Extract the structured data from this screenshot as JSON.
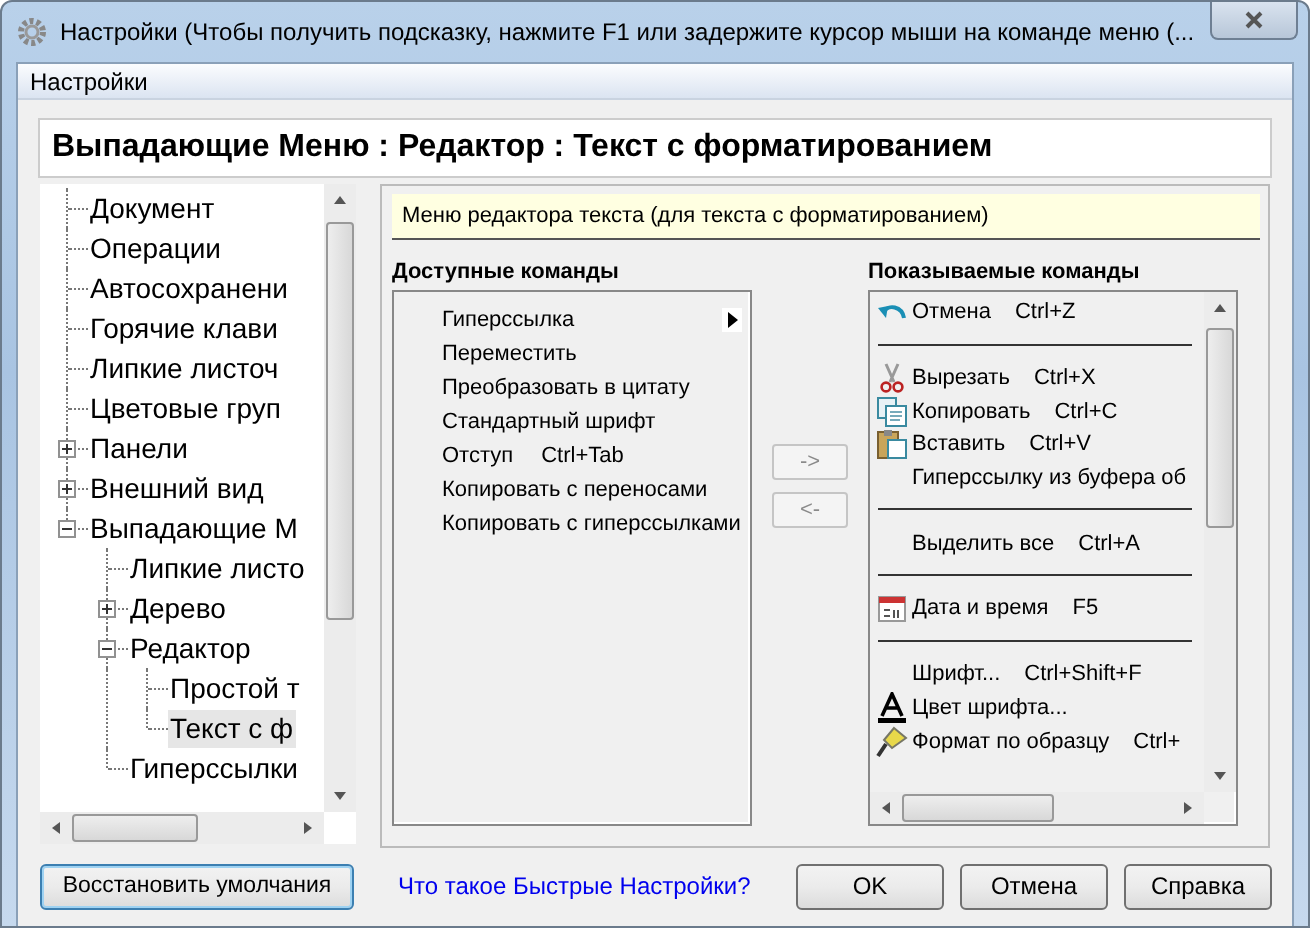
{
  "window": {
    "title": "Настройки (Чтобы получить подсказку, нажмите F1 или задержите курсор мыши на команде меню (..."
  },
  "menu_bar": [
    "Настройки"
  ],
  "page_header": "Выпадающие Меню : Редактор : Текст с форматированием",
  "tree": [
    {
      "label": "Документ",
      "selected": false
    },
    {
      "label": "Операции",
      "selected": false
    },
    {
      "label": "Автосохранени",
      "selected": false
    },
    {
      "label": "Горячие клави",
      "selected": false
    },
    {
      "label": "Липкие листоч",
      "selected": false
    },
    {
      "label": "Цветовые груп",
      "selected": false
    },
    {
      "label": "Панели",
      "selected": false,
      "expanded": false
    },
    {
      "label": "Внешний вид",
      "selected": false,
      "expanded": false
    },
    {
      "label": "Выпадающие М",
      "selected": false,
      "expanded": true,
      "children": [
        {
          "label": "Липкие листо",
          "selected": false
        },
        {
          "label": "Дерево",
          "selected": false,
          "expanded": false
        },
        {
          "label": "Редактор",
          "selected": false,
          "expanded": true,
          "children": [
            {
              "label": "Простой т",
              "selected": false
            },
            {
              "label": "Текст с ф",
              "selected": true
            }
          ]
        },
        {
          "label": "Гиперссылки",
          "selected": false
        }
      ]
    }
  ],
  "description": "Меню редактора текста (для текста с форматированием)",
  "available": {
    "heading": "Доступные команды",
    "items": [
      {
        "label": "Гиперссылка",
        "submenu": true
      },
      {
        "label": "Переместить"
      },
      {
        "label": "Преобразовать в цитату"
      },
      {
        "label": "Стандартный шрифт"
      },
      {
        "label": "Отступ",
        "shortcut": "Ctrl+Tab"
      },
      {
        "label": "Копировать с переносами"
      },
      {
        "label": "Копировать с гиперссылками"
      }
    ]
  },
  "move_buttons": [
    {
      "label": "->",
      "disabled": true
    },
    {
      "label": "<-",
      "disabled": true
    }
  ],
  "shown": {
    "heading": "Показываемые команды",
    "items": [
      {
        "kind": "command",
        "label": "Отмена",
        "shortcut": "Ctrl+Z"
      },
      {
        "kind": "separator"
      },
      {
        "kind": "command",
        "label": "Вырезать",
        "shortcut": "Ctrl+X"
      },
      {
        "kind": "command",
        "label": "Копировать",
        "shortcut": "Ctrl+C"
      },
      {
        "kind": "command",
        "label": "Вставить",
        "shortcut": "Ctrl+V"
      },
      {
        "kind": "command",
        "label": "Гиперссылку из буфера об"
      },
      {
        "kind": "separator"
      },
      {
        "kind": "command",
        "label": "Выделить все",
        "shortcut": "Ctrl+A"
      },
      {
        "kind": "separator"
      },
      {
        "kind": "command",
        "label": "Дата и время",
        "shortcut": "F5"
      },
      {
        "kind": "separator"
      },
      {
        "kind": "command",
        "label": "Шрифт...",
        "shortcut": "Ctrl+Shift+F"
      },
      {
        "kind": "command",
        "label": "Цвет шрифта..."
      },
      {
        "kind": "command",
        "label": "Формат по образцу",
        "shortcut": "Ctrl+"
      }
    ]
  },
  "restore_button": "Восстановить умолчания",
  "help_link": "Что такое Быстрые Настройки?",
  "buttons": [
    "OK",
    "Отмена",
    "Справка"
  ]
}
